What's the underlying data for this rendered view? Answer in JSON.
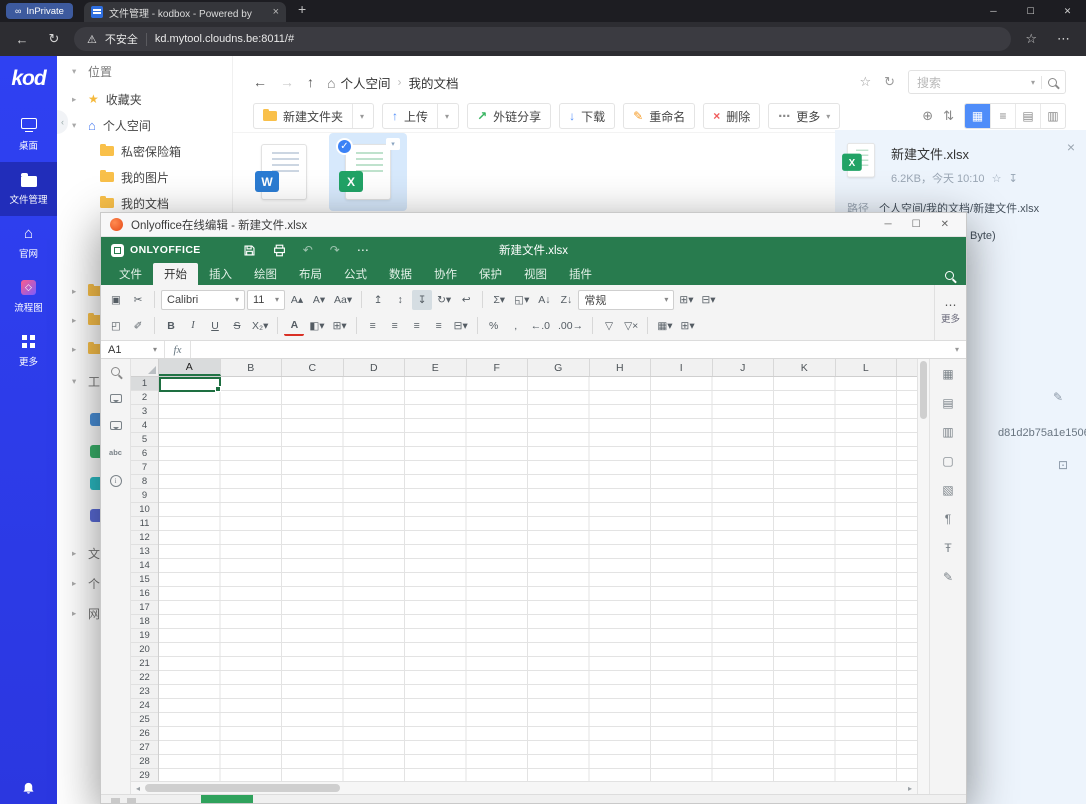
{
  "browser": {
    "inprivate_label": "InPrivate",
    "glasses_icon": "∞",
    "tab_title": "文件管理 - kodbox - Powered by",
    "tab_close": "×",
    "new_tab": "+",
    "win_min": "─",
    "win_max": "☐",
    "win_close": "✕",
    "back": "←",
    "reload": "↻",
    "warning_icon": "⚠",
    "security_label": "不安全",
    "url": "kd.mytool.cloudns.be:8011/#",
    "star": "☆",
    "more": "⋯"
  },
  "rail": {
    "logo": "kod",
    "items": [
      {
        "id": "desktop",
        "label": "桌面",
        "icon": "monitor",
        "active": false
      },
      {
        "id": "file-manager",
        "label": "文件管理",
        "icon": "folder",
        "active": true
      },
      {
        "id": "site",
        "label": "官网",
        "icon": "home",
        "active": false
      },
      {
        "id": "flowchart",
        "label": "流程图",
        "icon": "flow",
        "active": false
      },
      {
        "id": "more",
        "label": "更多",
        "icon": "grid",
        "active": false
      }
    ]
  },
  "tree": {
    "collapse_handle": "‹",
    "section_chevron": "▾",
    "section_label": "位置",
    "items": [
      {
        "id": "favorites",
        "chevron": "▸",
        "icon": "star",
        "label": "收藏夹",
        "indent": 0
      },
      {
        "id": "personal-space",
        "chevron": "▾",
        "icon": "home",
        "label": "个人空间",
        "indent": 0
      },
      {
        "id": "private-safe",
        "chevron": "",
        "icon": "folder",
        "label": "私密保险箱",
        "indent": 1
      },
      {
        "id": "my-pictures",
        "chevron": "",
        "icon": "folder",
        "label": "我的图片",
        "indent": 1
      },
      {
        "id": "my-documents",
        "chevron": "",
        "icon": "folder",
        "label": "我的文档",
        "indent": 1
      }
    ],
    "lower_items": [
      {
        "chevron": "▸",
        "icon": "folder",
        "label": ""
      },
      {
        "chevron": "▸",
        "icon": "folder",
        "label": ""
      },
      {
        "chevron": "▸",
        "icon": "folder",
        "label": ""
      }
    ],
    "tools_section": {
      "chevron": "▾",
      "label": "工"
    },
    "app_items": [
      {
        "color": "#4a90d9"
      },
      {
        "color": "#3bb26b"
      },
      {
        "color": "#2bbcc4"
      },
      {
        "color": "#5a6bd8"
      }
    ],
    "bottom_sections": [
      {
        "chevron": "▸",
        "label": "文"
      },
      {
        "chevron": "▸",
        "label": "个"
      },
      {
        "chevron": "▸",
        "label": "网"
      }
    ]
  },
  "filebar": {
    "back": "←",
    "forward": "→",
    "up": "↑",
    "crumb_sep": "›",
    "crumbs": [
      {
        "label": "个人空间",
        "home": true
      },
      {
        "label": "我的文档",
        "home": false
      }
    ],
    "fav_star": "☆",
    "refresh": "↻",
    "search_placeholder": "搜索",
    "search_caret": "▾",
    "toolbar": [
      {
        "id": "new-folder",
        "label": "新建文件夹",
        "icon": "folder",
        "color": "#f7b84b",
        "split": true
      },
      {
        "id": "upload",
        "label": "上传",
        "icon": "↑",
        "color": "#4f8df9",
        "split": true
      },
      {
        "id": "share",
        "label": "外链分享",
        "icon": "↗",
        "color": "#35b45f",
        "split": false
      },
      {
        "id": "download",
        "label": "下载",
        "icon": "↓",
        "color": "#4f8df9",
        "split": false
      },
      {
        "id": "rename",
        "label": "重命名",
        "icon": "✎",
        "color": "#f59a23",
        "split": false
      },
      {
        "id": "delete",
        "label": "删除",
        "icon": "×",
        "color": "#f05b5b",
        "split": false
      },
      {
        "id": "more",
        "label": "更多",
        "icon": "⋯",
        "color": "#888888",
        "split": false,
        "caret": true
      }
    ],
    "zoom_icon": "⊕",
    "sort_icon": "⇅",
    "views": [
      {
        "id": "grid",
        "glyph": "▦",
        "active": true
      },
      {
        "id": "list",
        "glyph": "≡",
        "active": false
      },
      {
        "id": "detail",
        "glyph": "▤",
        "active": false
      },
      {
        "id": "columns",
        "glyph": "▥",
        "active": false
      }
    ]
  },
  "files": {
    "word": {
      "letter": "W",
      "color": "#2b7cd3"
    },
    "excel": {
      "letter": "X",
      "color": "#21a366",
      "check": "✓",
      "caret": "▾"
    }
  },
  "detail": {
    "close": "×",
    "file_name": "新建文件.xlsx",
    "meta": "6.2KB，今天 10:10",
    "star": "☆",
    "download_icon": "↧",
    "path_label": "路径",
    "path_value": "个人空间/我的文档/新建文件.xlsx",
    "byte_fragment": "Byte)",
    "hash_fragment": "d81d2b75a1e1506...",
    "edit_icon": "✎",
    "extra_icon": "⊡"
  },
  "oo": {
    "window_title": "Onlyoffice在线编辑 - 新建文件.xlsx",
    "win_min": "─",
    "win_max": "☐",
    "win_close": "✕",
    "brand": "ONLYOFFICE",
    "doc_title": "新建文件.xlsx",
    "quick": [
      {
        "name": "save-icon",
        "shape": "save"
      },
      {
        "name": "print-icon",
        "shape": "print"
      },
      {
        "name": "undo-icon",
        "glyph": "↶",
        "disabled": true
      },
      {
        "name": "redo-icon",
        "glyph": "↷",
        "disabled": true
      },
      {
        "name": "quick-more-icon",
        "glyph": "⋯"
      }
    ],
    "tabs": [
      {
        "label": "文件",
        "active": false
      },
      {
        "label": "开始",
        "active": true
      },
      {
        "label": "插入",
        "active": false
      },
      {
        "label": "绘图",
        "active": false
      },
      {
        "label": "布局",
        "active": false
      },
      {
        "label": "公式",
        "active": false
      },
      {
        "label": "数据",
        "active": false
      },
      {
        "label": "协作",
        "active": false
      },
      {
        "label": "保护",
        "active": false
      },
      {
        "label": "视图",
        "active": false
      },
      {
        "label": "插件",
        "active": false
      }
    ],
    "row1": [
      {
        "name": "paste",
        "glyph": "▣"
      },
      {
        "name": "cut",
        "glyph": "✂"
      },
      {
        "sep": true
      },
      {
        "name": "font-name",
        "select": true,
        "value": "Calibri",
        "w": 84
      },
      {
        "name": "font-size",
        "select": true,
        "value": "11",
        "w": 38
      },
      {
        "name": "font-increase",
        "glyph": "A▴"
      },
      {
        "name": "font-decrease",
        "glyph": "A▾"
      },
      {
        "name": "change-case",
        "glyph": "Aa▾"
      },
      {
        "sep": true
      },
      {
        "name": "align-top",
        "glyph": "↥"
      },
      {
        "name": "align-middle",
        "glyph": "↕"
      },
      {
        "name": "align-bottom",
        "glyph": "↧",
        "active": true
      },
      {
        "name": "orientation",
        "glyph": "↻▾"
      },
      {
        "name": "wrap-text",
        "glyph": "↩"
      },
      {
        "sep": true
      },
      {
        "name": "summation",
        "glyph": "Σ▾"
      },
      {
        "name": "clear",
        "glyph": "◱▾"
      },
      {
        "name": "sort-asc",
        "glyph": "A↓"
      },
      {
        "name": "sort-desc",
        "glyph": "Z↓"
      },
      {
        "name": "number-format",
        "select": true,
        "value": "常规",
        "w": 96
      },
      {
        "name": "insert-cells",
        "glyph": "⊞▾"
      },
      {
        "name": "delete-cells",
        "glyph": "⊟▾"
      }
    ],
    "row2": [
      {
        "name": "copy",
        "glyph": "◰"
      },
      {
        "name": "copy-style",
        "glyph": "✐"
      },
      {
        "sep": true
      },
      {
        "name": "bold",
        "glyph": "B",
        "cls": "b"
      },
      {
        "name": "italic",
        "glyph": "I",
        "cls": "i"
      },
      {
        "name": "underline",
        "glyph": "U",
        "cls": "u"
      },
      {
        "name": "strikeout",
        "glyph": "S",
        "cls": "s"
      },
      {
        "name": "subscript",
        "glyph": "X₂▾"
      },
      {
        "sep": true
      },
      {
        "name": "font-color",
        "glyph": "A",
        "cls": "fc"
      },
      {
        "name": "fill-color",
        "glyph": "◧▾"
      },
      {
        "name": "borders",
        "glyph": "⊞▾"
      },
      {
        "sep": true
      },
      {
        "name": "align-left",
        "glyph": "≡"
      },
      {
        "name": "align-center",
        "glyph": "≡"
      },
      {
        "name": "align-right",
        "glyph": "≡"
      },
      {
        "name": "justify",
        "glyph": "≡"
      },
      {
        "name": "merge-cells",
        "glyph": "⊟▾"
      },
      {
        "sep": true
      },
      {
        "name": "percent-style",
        "glyph": "%"
      },
      {
        "name": "comma-style",
        "glyph": ","
      },
      {
        "name": "decimal-decrease",
        "glyph": "←.0"
      },
      {
        "name": "decimal-increase",
        "glyph": ".00→"
      },
      {
        "sep": true
      },
      {
        "name": "filter",
        "glyph": "▽"
      },
      {
        "name": "clear-filter",
        "glyph": "▽×"
      },
      {
        "sep": true
      },
      {
        "name": "cond-format",
        "glyph": "▦▾"
      },
      {
        "name": "table-template",
        "glyph": "⊞▾"
      }
    ],
    "more_dots": "⋯",
    "more_label": "更多",
    "cell_ref": "A1",
    "cell_ref_caret": "▾",
    "fx": "fx",
    "formula_caret": "▾",
    "left_icons": [
      {
        "name": "find-icon",
        "shape": "mag"
      },
      {
        "name": "comments-icon",
        "shape": "bubble"
      },
      {
        "name": "chat-icon",
        "shape": "bubble"
      },
      {
        "name": "spellcheck-icon",
        "shape": "text",
        "glyph": "abc"
      },
      {
        "name": "about-icon",
        "shape": "circle",
        "glyph": "i"
      }
    ],
    "right_icons": [
      {
        "name": "cell-settings-icon",
        "glyph": "▦"
      },
      {
        "name": "table-settings-icon",
        "glyph": "▤"
      },
      {
        "name": "pivot-settings-icon",
        "glyph": "▥"
      },
      {
        "name": "image-settings-icon",
        "glyph": "▢"
      },
      {
        "name": "chart-settings-icon",
        "glyph": "▧"
      },
      {
        "name": "paragraph-settings-icon",
        "glyph": "¶"
      },
      {
        "name": "textart-settings-icon",
        "glyph": "Ŧ"
      },
      {
        "name": "signature-settings-icon",
        "glyph": "✎"
      }
    ],
    "columns": [
      "A",
      "B",
      "C",
      "D",
      "E",
      "F",
      "G",
      "H",
      "I",
      "J",
      "K",
      "L"
    ],
    "rows": 29,
    "hscroll_left": "◂",
    "hscroll_right": "▸"
  }
}
